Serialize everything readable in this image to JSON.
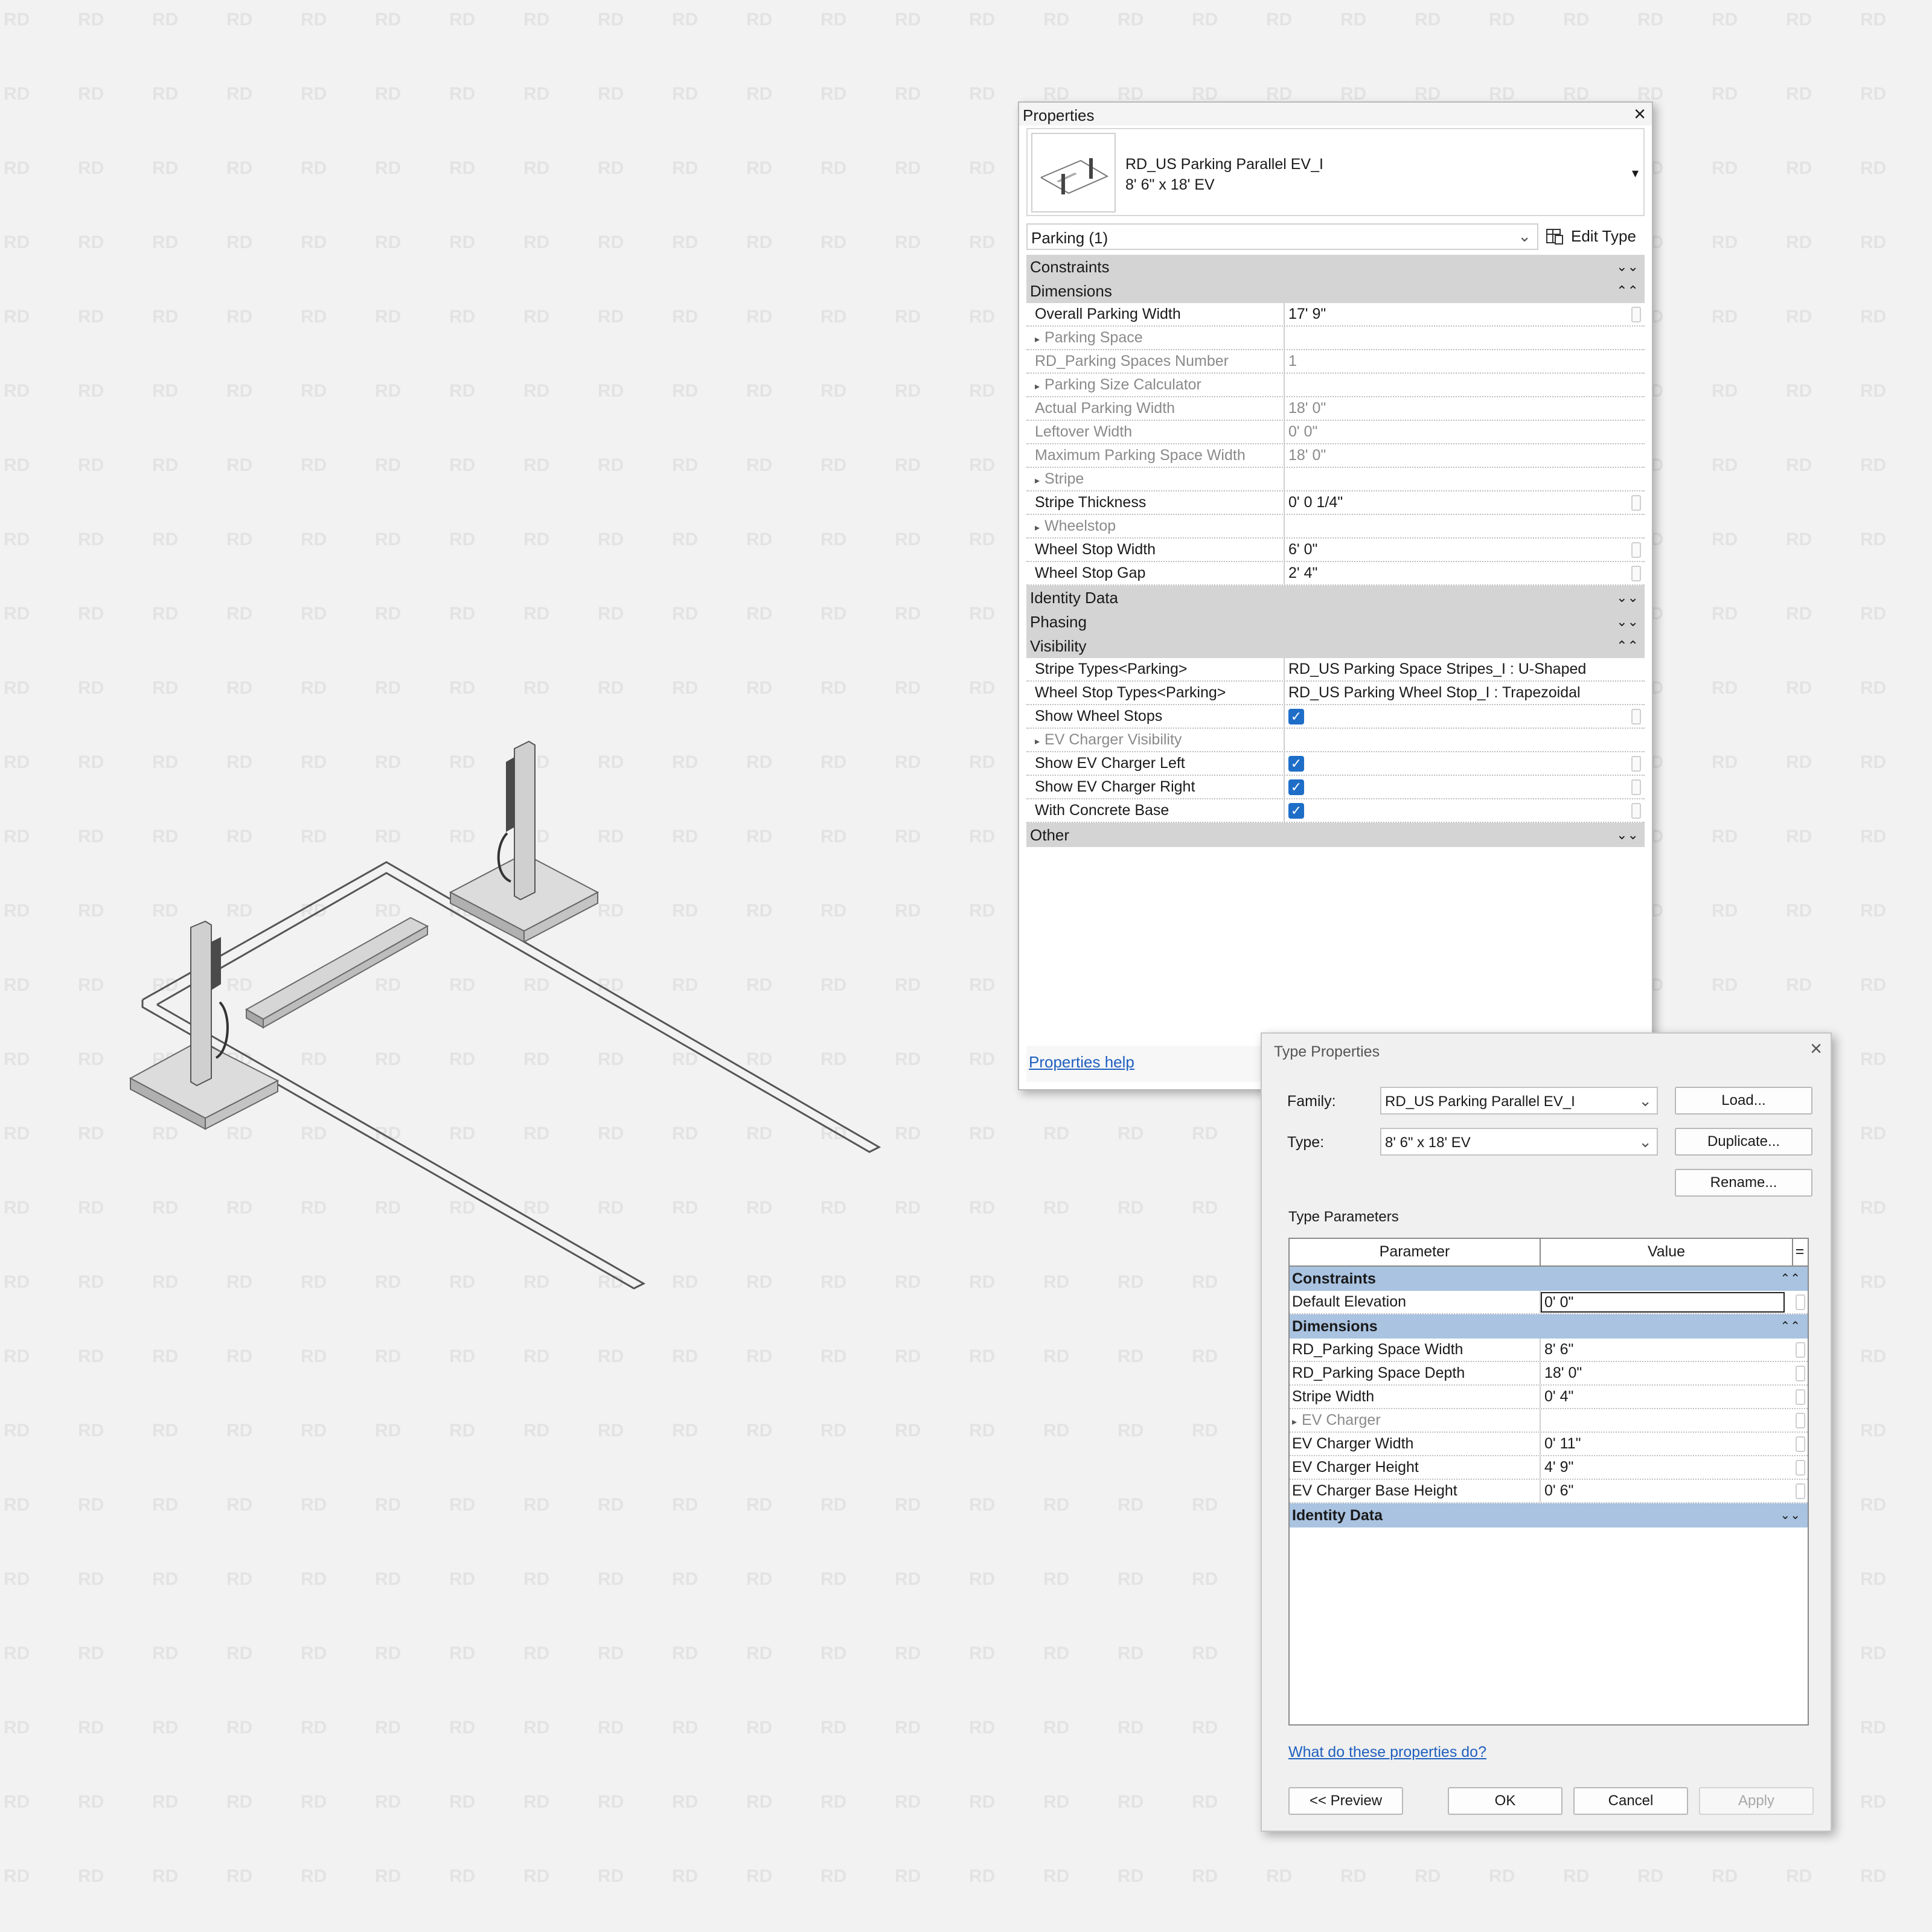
{
  "watermark": "RD",
  "properties": {
    "title": "Properties",
    "close_icon": "×",
    "family_name": "RD_US Parking Parallel EV_I",
    "type_name": "8' 6\" x 18' EV",
    "instance_selector": "Parking (1)",
    "edit_type_label": "Edit Type",
    "help_link": "Properties help",
    "groups": [
      {
        "label": "Constraints",
        "chevron": "⌄⌄"
      },
      {
        "label": "Dimensions",
        "chevron": "⌃⌃"
      },
      {
        "label": "Identity Data",
        "chevron": "⌄⌄"
      },
      {
        "label": "Phasing",
        "chevron": "⌄⌄"
      },
      {
        "label": "Visibility",
        "chevron": "⌃⌃"
      },
      {
        "label": "Other",
        "chevron": "⌄⌄"
      }
    ],
    "dimensions_rows": [
      {
        "k": "Overall Parking Width",
        "v": "17'  9\""
      },
      {
        "k": "Parking Space",
        "v": ""
      },
      {
        "k": "RD_Parking Spaces Number",
        "v": "1"
      },
      {
        "k": "Parking Size Calculator",
        "v": ""
      },
      {
        "k": "Actual Parking Width",
        "v": "18'  0\""
      },
      {
        "k": "Leftover Width",
        "v": "0'  0\""
      },
      {
        "k": "Maximum Parking Space Width",
        "v": "18'  0\""
      },
      {
        "k": "Stripe",
        "v": ""
      },
      {
        "k": "Stripe Thickness",
        "v": "0'  0 1/4\""
      },
      {
        "k": "Wheelstop",
        "v": ""
      },
      {
        "k": "Wheel Stop Width",
        "v": "6'  0\""
      },
      {
        "k": "Wheel Stop Gap",
        "v": "2'  4\""
      }
    ],
    "visibility_rows": [
      {
        "k": "Stripe Types<Parking>",
        "v": "RD_US Parking Space Stripes_I : U-Shaped"
      },
      {
        "k": "Wheel Stop Types<Parking>",
        "v": "RD_US Parking Wheel Stop_I : Trapezoidal"
      },
      {
        "k": "Show Wheel Stops",
        "v": "✓"
      },
      {
        "k": "EV Charger Visibility",
        "v": ""
      },
      {
        "k": "Show EV Charger Left",
        "v": "✓"
      },
      {
        "k": "Show EV Charger Right",
        "v": "✓"
      },
      {
        "k": "With Concrete Base",
        "v": "✓"
      }
    ]
  },
  "type_properties": {
    "title": "Type Properties",
    "close_icon": "×",
    "family_label": "Family:",
    "family_value": "RD_US Parking Parallel EV_I",
    "type_label": "Type:",
    "type_value": "8' 6\" x 18' EV",
    "load_button": "Load...",
    "duplicate_button": "Duplicate...",
    "rename_button": "Rename...",
    "section_label": "Type Parameters",
    "col_parameter": "Parameter",
    "col_value": "Value",
    "col_extra": "=",
    "constraints": {
      "label": "Constraints",
      "chevron": "⌃⌃"
    },
    "default_elevation": {
      "k": "Default Elevation",
      "v": "0'  0\""
    },
    "dimensions": {
      "label": "Dimensions",
      "chevron": "⌃⌃"
    },
    "dim_rows": [
      {
        "k": "RD_Parking Space Width",
        "v": "8'  6\""
      },
      {
        "k": "RD_Parking Space Depth",
        "v": "18'  0\""
      },
      {
        "k": "Stripe Width",
        "v": "0'  4\""
      },
      {
        "k": "EV Charger",
        "v": ""
      },
      {
        "k": "EV Charger Width",
        "v": "0'  11\""
      },
      {
        "k": "EV Charger Height",
        "v": "4'  9\""
      },
      {
        "k": "EV Charger Base Height",
        "v": "0'  6\""
      }
    ],
    "identity": {
      "label": "Identity Data",
      "chevron": "⌄⌄"
    },
    "help_link": "What do these properties do?",
    "preview_button": "<< Preview",
    "ok_button": "OK",
    "cancel_button": "Cancel",
    "apply_button": "Apply"
  }
}
